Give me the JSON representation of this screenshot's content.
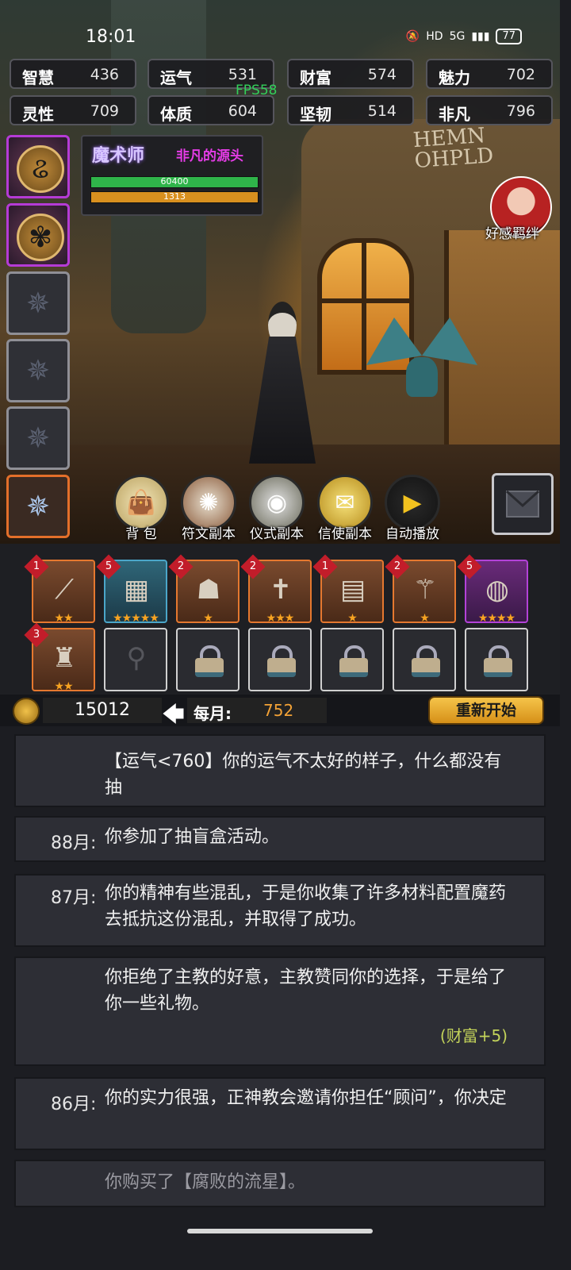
{
  "status_bar": {
    "time": "18:01",
    "network": "5G",
    "hd": "HD",
    "battery": "77"
  },
  "fps": "FPS58",
  "stats": [
    {
      "label": "智慧",
      "value": "436"
    },
    {
      "label": "运气",
      "value": "531"
    },
    {
      "label": "财富",
      "value": "574"
    },
    {
      "label": "魅力",
      "value": "702"
    },
    {
      "label": "灵性",
      "value": "709"
    },
    {
      "label": "体质",
      "value": "604"
    },
    {
      "label": "坚韧",
      "value": "514"
    },
    {
      "label": "非凡",
      "value": "796"
    }
  ],
  "character": {
    "class_name": "魔术师",
    "title": "非凡的源头",
    "hp_value": "60400",
    "hp_fraction": 1.0,
    "hp_color": "#2fb44a",
    "mp_value": "1313",
    "mp_fraction": 1.0,
    "mp_color": "#d8901f"
  },
  "scene": {
    "sign_text": "HEMN OHPLD"
  },
  "affection": {
    "label": "好感羁绊"
  },
  "side_slots": [
    {
      "icon": "serpent-medal-icon",
      "state": "purple"
    },
    {
      "icon": "tree-medal-icon",
      "state": "purple"
    },
    {
      "icon": "empty-star-slot-icon",
      "state": "gray"
    },
    {
      "icon": "empty-star-slot-icon",
      "state": "gray"
    },
    {
      "icon": "empty-star-slot-icon",
      "state": "gray"
    },
    {
      "icon": "frost-star-icon",
      "state": "orange"
    }
  ],
  "actions": {
    "bag": "背 包",
    "rune_dungeon": "符文副本",
    "ritual_dungeon": "仪式副本",
    "messenger_dungeon": "信使副本",
    "autoplay": "自动播放"
  },
  "inventory": [
    {
      "icon": "telescope-icon",
      "tier": "orange",
      "count": "1",
      "stars": 2
    },
    {
      "icon": "tarot-card-icon",
      "tier": "blue",
      "count": "5",
      "stars": 5
    },
    {
      "icon": "iron-mask-icon",
      "tier": "orange",
      "count": "2",
      "stars": 1
    },
    {
      "icon": "cross-icon",
      "tier": "orange",
      "count": "2",
      "stars": 3
    },
    {
      "icon": "book-icon",
      "tier": "orange",
      "count": "1",
      "stars": 1
    },
    {
      "icon": "scepter-icon",
      "tier": "orange",
      "count": "2",
      "stars": 1
    },
    {
      "icon": "crystal-ball-icon",
      "tier": "purple",
      "count": "5",
      "stars": 4
    },
    {
      "icon": "armor-icon",
      "tier": "orange",
      "count": "3",
      "stars": 2
    },
    {
      "icon": "cane-silhouette-icon",
      "tier": "gray",
      "count": "",
      "stars": 0
    },
    {
      "icon": "lock-icon",
      "tier": "gray",
      "count": "",
      "stars": 0
    },
    {
      "icon": "lock-icon",
      "tier": "gray",
      "count": "",
      "stars": 0
    },
    {
      "icon": "lock-icon",
      "tier": "gray",
      "count": "",
      "stars": 0
    },
    {
      "icon": "lock-icon",
      "tier": "gray",
      "count": "",
      "stars": 0
    },
    {
      "icon": "lock-icon",
      "tier": "gray",
      "count": "",
      "stars": 0
    }
  ],
  "currency": {
    "gold": "15012",
    "monthly_label": "每月:",
    "monthly_value": "752",
    "restart_label": "重新开始"
  },
  "log": [
    {
      "month": "",
      "text": "【运气<760】你的运气不太好的样子，什么都没有抽",
      "effect": "",
      "dim": false
    },
    {
      "month": "88月:",
      "text": "你参加了抽盲盒活动。",
      "effect": "",
      "dim": false
    },
    {
      "month": "87月:",
      "text": "你的精神有些混乱，于是你收集了许多材料配置魔药去抵抗这份混乱，并取得了成功。",
      "effect": "",
      "dim": false
    },
    {
      "month": "",
      "text": "你拒绝了主教的好意，主教赞同你的选择，于是给了你一些礼物。",
      "effect": "(财富+5)",
      "dim": false
    },
    {
      "month": "86月:",
      "text": "你的实力很强，正神教会邀请你担任“顾问”，你决定",
      "effect": "",
      "dim": false
    },
    {
      "month": "",
      "text": "你购买了【腐败的流星】。",
      "effect": "",
      "dim": true
    }
  ]
}
